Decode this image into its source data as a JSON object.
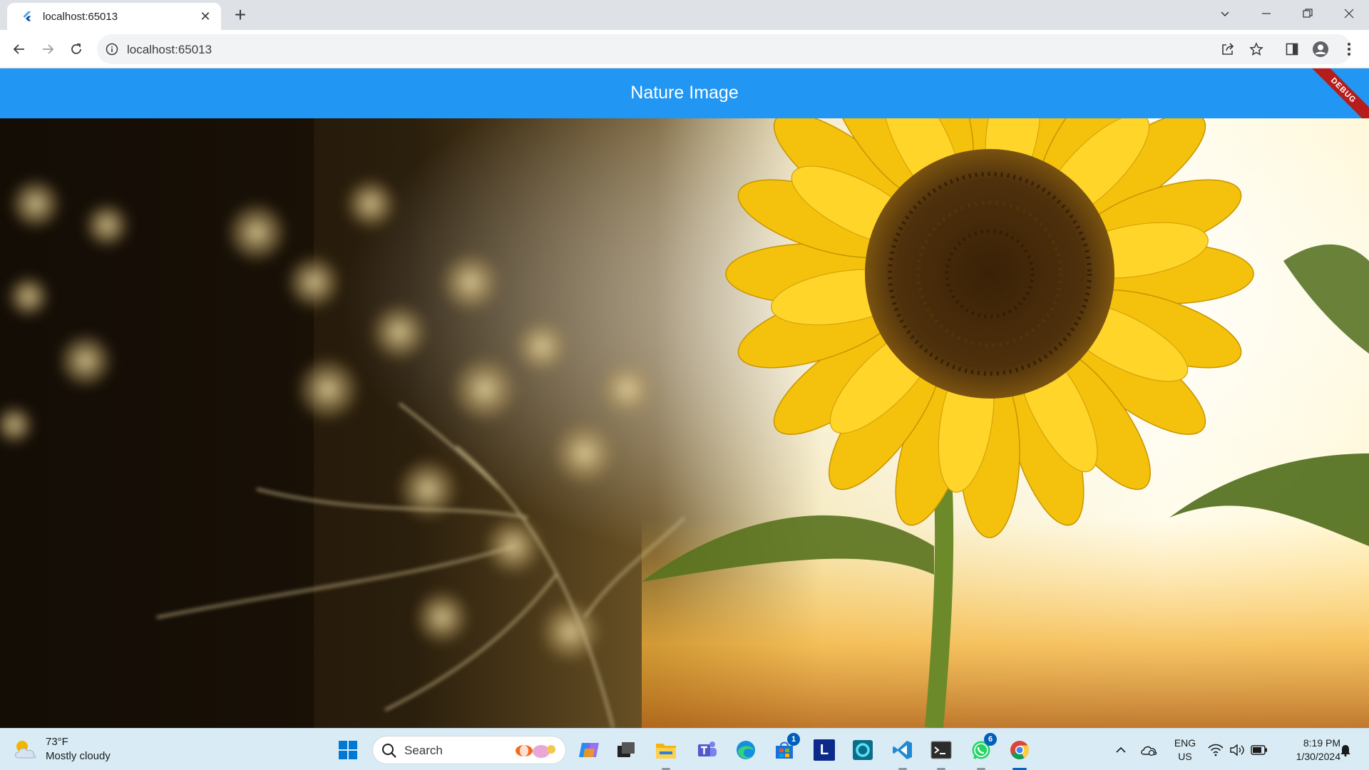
{
  "browser": {
    "tab_title": "localhost:65013",
    "url": "localhost:65013"
  },
  "app": {
    "title": "Nature Image",
    "debug_banner": "DEBUG",
    "theme_color": "#2196f3"
  },
  "image": {
    "subject": "sunflower-photo"
  },
  "taskbar": {
    "weather_temp": "73°F",
    "weather_condition": "Mostly cloudy",
    "search_placeholder": "Search",
    "apps": [
      {
        "name": "windows-start-icon"
      },
      {
        "name": "copilot-icon"
      },
      {
        "name": "task-view-icon"
      },
      {
        "name": "file-explorer-icon"
      },
      {
        "name": "teams-icon"
      },
      {
        "name": "edge-icon"
      },
      {
        "name": "microsoft-store-icon",
        "badge": "1"
      },
      {
        "name": "l-app-icon",
        "label": "L"
      },
      {
        "name": "cortana-icon"
      },
      {
        "name": "vscode-icon"
      },
      {
        "name": "terminal-icon"
      },
      {
        "name": "whatsapp-icon",
        "badge": "6"
      },
      {
        "name": "chrome-icon"
      }
    ],
    "language_line1": "ENG",
    "language_line2": "US",
    "time": "8:19 PM",
    "date": "1/30/2024"
  }
}
